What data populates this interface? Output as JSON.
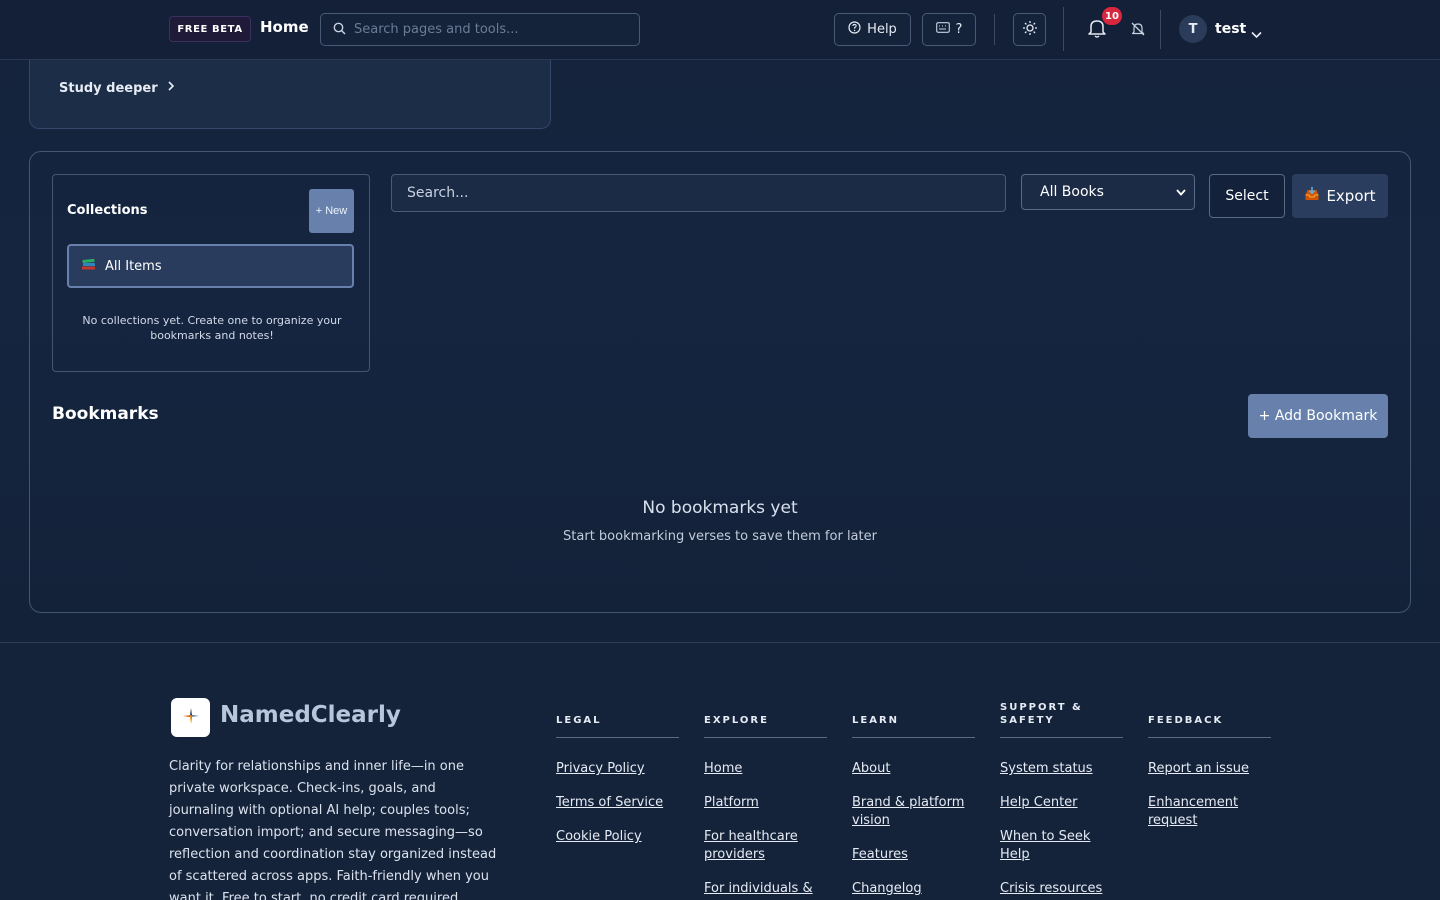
{
  "header": {
    "badge": "FREE BETA",
    "home": "Home",
    "search_placeholder": "Search pages and tools...",
    "help": "Help",
    "shortcuts": "?",
    "notification_count": "10",
    "user_initial": "T",
    "username": "test"
  },
  "study": {
    "link": "Study deeper"
  },
  "collections": {
    "title": "Collections",
    "new_button": "+ New",
    "all_items": "All Items",
    "empty": "No collections yet. Create one to organize your bookmarks and notes!"
  },
  "toolbar": {
    "search_placeholder": "Search...",
    "filter_selected": "All Books",
    "select": "Select",
    "export": "Export"
  },
  "bookmarks": {
    "title": "Bookmarks",
    "add_button": "+ Add Bookmark",
    "empty_title": "No bookmarks yet",
    "empty_sub": "Start bookmarking verses to save them for later"
  },
  "footer": {
    "brand": "NamedClearly",
    "tagline": "Clarity for relationships and inner life—in one private workspace. Check-ins, goals, and journaling with optional AI help; couples tools; conversation import; and secure messaging—so reflection and coordination stay organized instead of scattered across apps. Faith-friendly when you want it. Free to start, no credit card required.",
    "columns": [
      {
        "heading": "LEGAL",
        "links": [
          "Privacy Policy",
          "Terms of Service",
          "Cookie Policy"
        ]
      },
      {
        "heading": "EXPLORE",
        "links": [
          "Home",
          "Platform",
          "For healthcare providers",
          "For individuals &"
        ]
      },
      {
        "heading": "LEARN",
        "links": [
          "About",
          "Brand & platform vision",
          "Features",
          "Changelog"
        ]
      },
      {
        "heading": "SUPPORT & SAFETY",
        "links": [
          "System status",
          "Help Center",
          "When to Seek Help",
          "Crisis resources"
        ]
      },
      {
        "heading": "FEEDBACK",
        "links": [
          "Report an issue",
          "Enhancement request"
        ]
      }
    ]
  }
}
